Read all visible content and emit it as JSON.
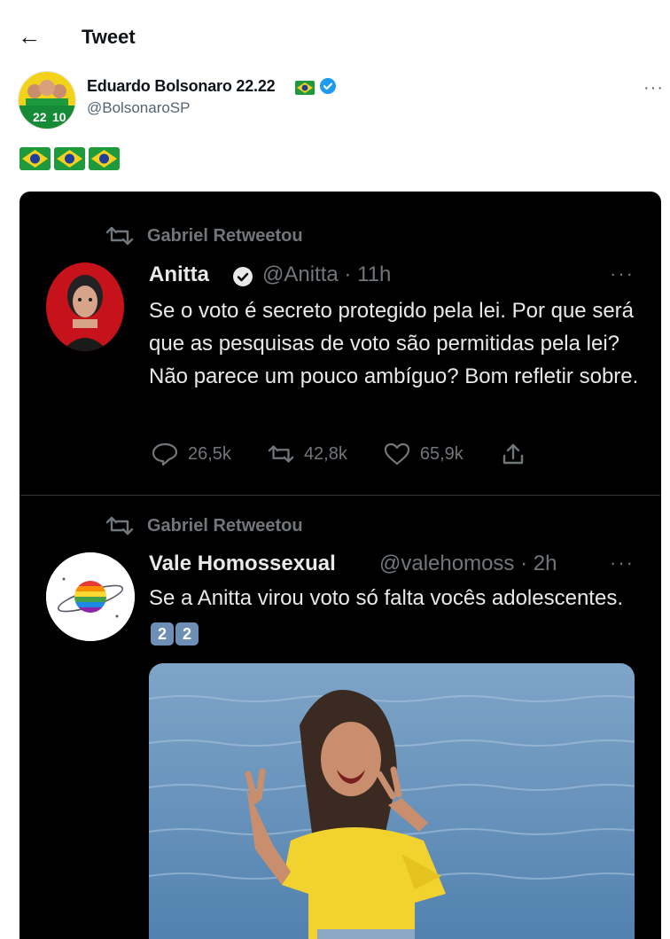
{
  "header": {
    "back_icon": "arrow-left-icon",
    "title": "Tweet"
  },
  "author": {
    "name": "Eduardo Bolsonaro 22.22",
    "handle": "@BolsonaroSP",
    "avatar_text_left": "22",
    "avatar_text_right": "10",
    "verified_icon": "verified-badge-icon",
    "more_icon": "more-options-icon",
    "more_label": "···"
  },
  "tweet": {
    "flags": [
      "brazil-flag-icon",
      "brazil-flag-icon",
      "brazil-flag-icon"
    ]
  },
  "embedded": [
    {
      "retweet_label": "Gabriel Retweetou",
      "name": "Anitta",
      "handle": "@Anitta · 11h",
      "more_label": "···",
      "text": "Se o voto é secreto protegido pela lei. Por que será que as pesquisas de voto são permitidas pela lei? Não parece um pouco ambíguo? Bom refletir sobre.",
      "replies": "26,5k",
      "retweets": "42,8k",
      "likes": "65,9k"
    },
    {
      "retweet_label": "Gabriel Retweetou",
      "name": "Vale Homossexual",
      "handle": "@valehomoss · 2h",
      "more_label": "···",
      "text": "Se a Anitta virou voto só falta vocês adolescentes.",
      "keycaps": [
        "2",
        "2"
      ]
    }
  ],
  "colors": {
    "dark_bg": "#000000",
    "muted": "#71767b",
    "verified": "#1d9bf0",
    "yellow": "#f2d22e"
  }
}
